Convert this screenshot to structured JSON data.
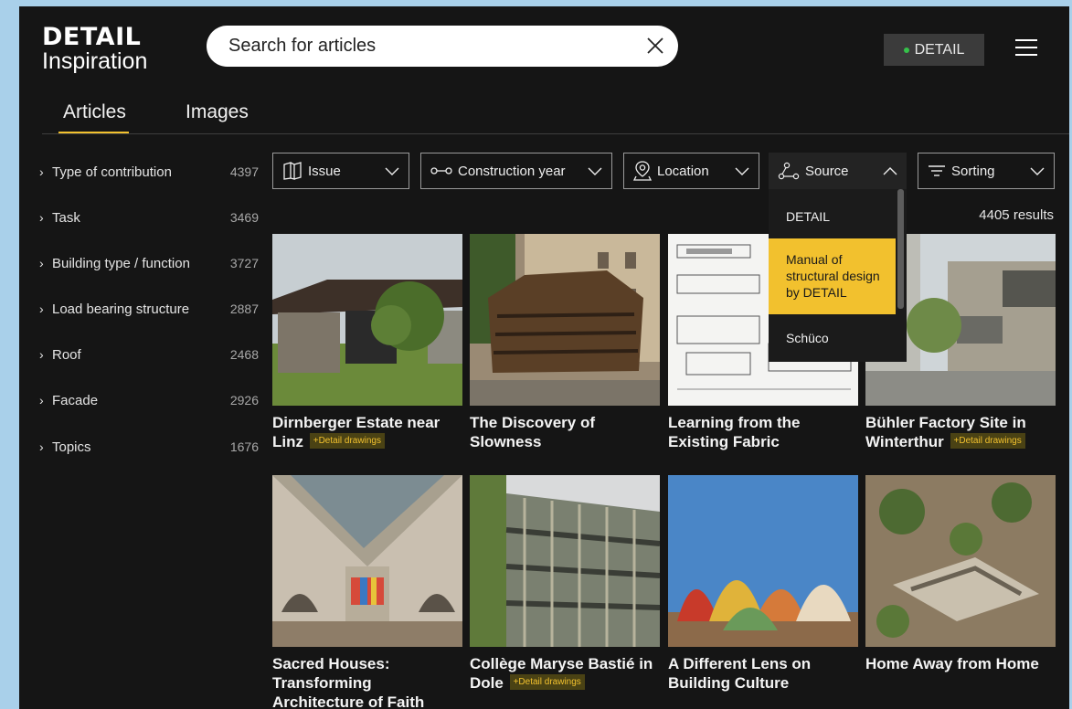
{
  "header": {
    "logo_line1": "DETAIL",
    "logo_line2": "Inspiration",
    "search_placeholder": "Search for articles",
    "badge_label": "DETAIL",
    "badge_dot_color": "#35c14a"
  },
  "tabs": [
    {
      "label": "Articles",
      "active": true
    },
    {
      "label": "Images",
      "active": false
    }
  ],
  "sidebar": {
    "items": [
      {
        "label": "Type of contribution",
        "count": "4397"
      },
      {
        "label": "Task",
        "count": "3469"
      },
      {
        "label": "Building type / function",
        "count": "3727"
      },
      {
        "label": "Load bearing structure",
        "count": "2887"
      },
      {
        "label": "Roof",
        "count": "2468"
      },
      {
        "label": "Facade",
        "count": "2926"
      },
      {
        "label": "Topics",
        "count": "1676"
      }
    ]
  },
  "filters": [
    {
      "label": "Issue",
      "icon": "book-icon"
    },
    {
      "label": "Construction year",
      "icon": "timeline-icon"
    },
    {
      "label": "Location",
      "icon": "map-pin-icon"
    },
    {
      "label": "Source",
      "icon": "source-nodes-icon",
      "expanded": true
    },
    {
      "label": "Sorting",
      "icon": "sort-icon"
    }
  ],
  "source_dropdown": {
    "options": [
      "DETAIL",
      "Manual of structural design by DETAIL",
      "Schüco"
    ],
    "highlighted": "Manual of structural design by DETAIL"
  },
  "results_label": "4405 results",
  "detail_tag": "+Detail drawings",
  "accent_color": "#f2c12e",
  "cards": [
    {
      "title": "Dirnberger Estate near Linz",
      "tag": true
    },
    {
      "title": "The Discovery of Slowness",
      "tag": false
    },
    {
      "title": "Learning from the Existing Fabric",
      "tag": false
    },
    {
      "title": "Bühler Factory Site in Winterthur",
      "tag": true
    },
    {
      "title": "Sacred Houses: Transforming Architecture of Faith",
      "tag": false
    },
    {
      "title": "Collège Maryse Bastié in Dole",
      "tag": true
    },
    {
      "title": "A Different Lens on Building Culture",
      "tag": false
    },
    {
      "title": "Home Away from Home",
      "tag": false
    }
  ]
}
